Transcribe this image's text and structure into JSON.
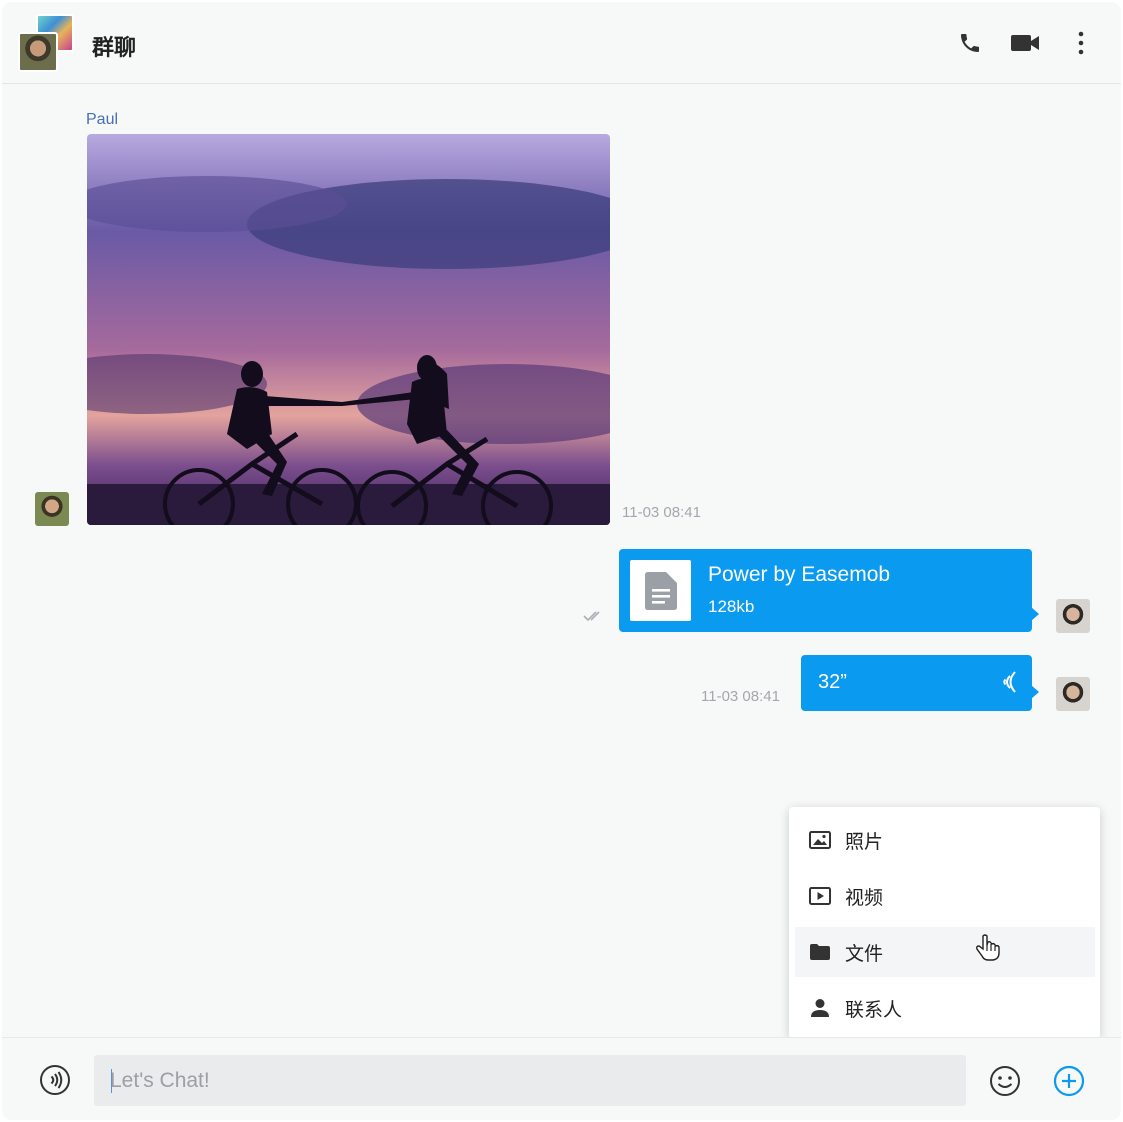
{
  "header": {
    "title": "群聊",
    "icons": [
      "group-avatar",
      "phone-icon",
      "video-camera-icon",
      "more-vertical-icon"
    ]
  },
  "messages": {
    "incoming": {
      "sender": "Paul",
      "time": "11-03 08:41",
      "type": "image"
    },
    "file_message": {
      "file_name": "Power by Easemob",
      "file_size": "128kb"
    },
    "voice_message": {
      "duration": "32”",
      "time": "11-03 08:41"
    }
  },
  "attach_menu": {
    "items": [
      {
        "label": "照片",
        "icon": "image-icon"
      },
      {
        "label": "视频",
        "icon": "video-play-icon"
      },
      {
        "label": "文件",
        "icon": "folder-icon"
      },
      {
        "label": "联系人",
        "icon": "person-icon"
      }
    ],
    "hovered": "文件"
  },
  "composer": {
    "placeholder": "Let's Chat!"
  },
  "colors": {
    "accent": "#0a9aef",
    "background": "#f7f8f8",
    "sender_name": "#4a6fb3"
  }
}
